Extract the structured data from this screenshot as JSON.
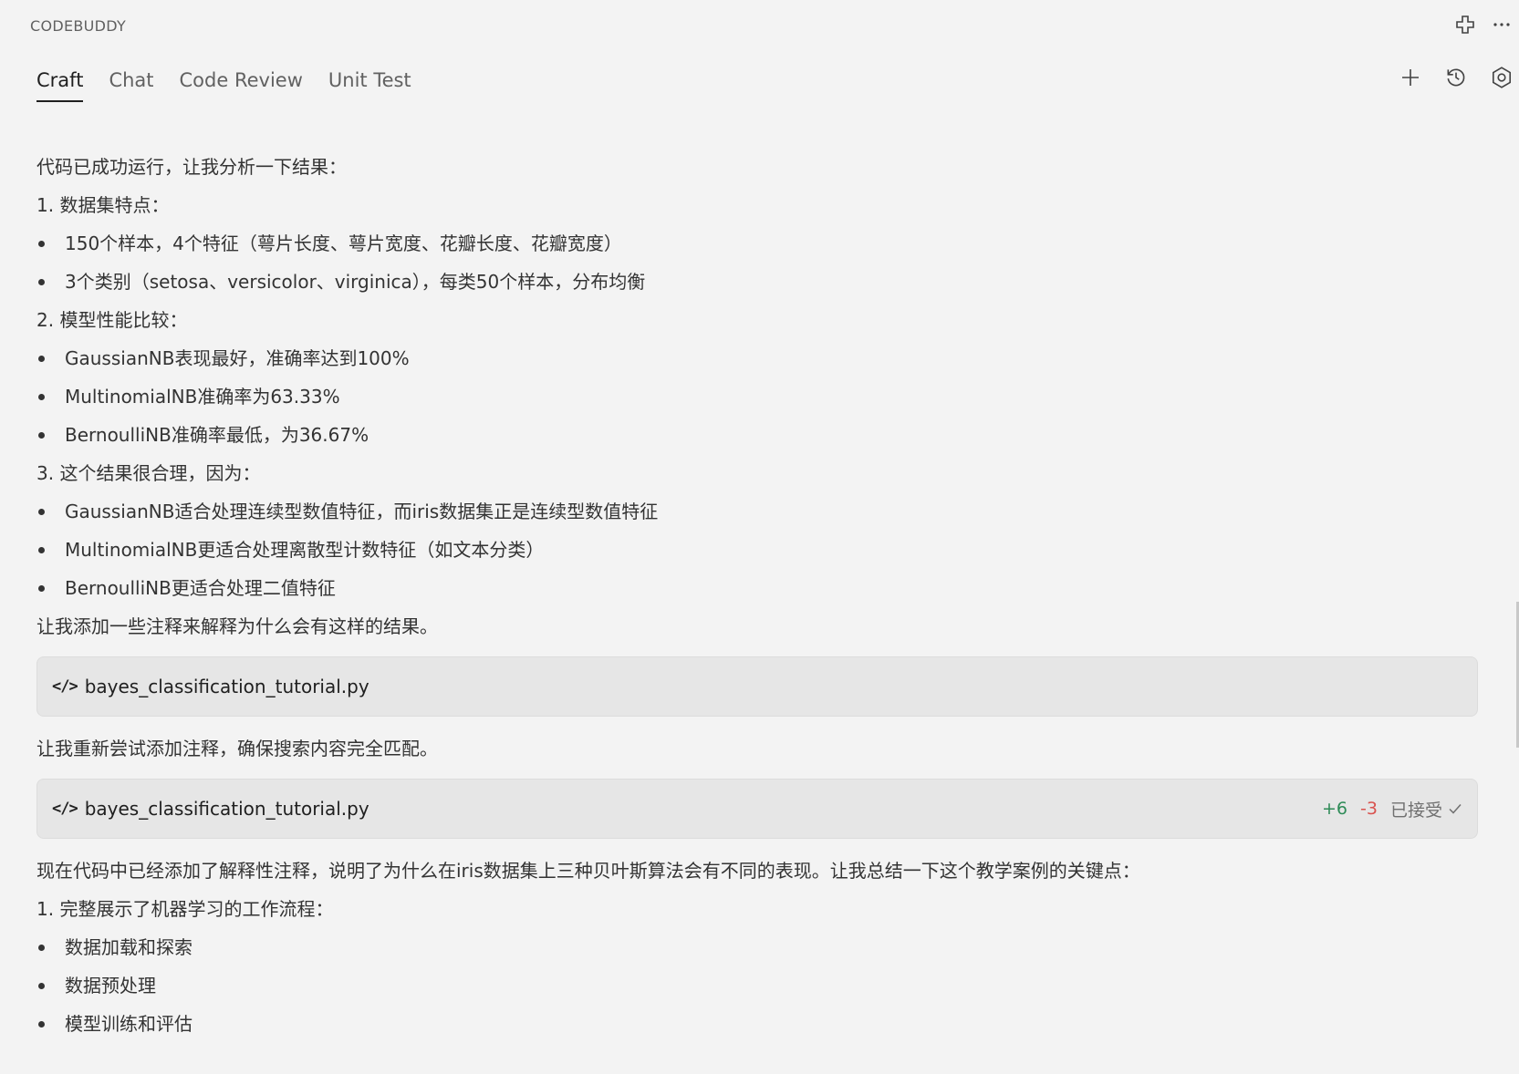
{
  "app": {
    "title": "CODEBUDDY"
  },
  "top_actions": [
    {
      "name": "extensions-icon"
    },
    {
      "name": "more-icon"
    }
  ],
  "tabs": [
    {
      "label": "Craft",
      "active": true
    },
    {
      "label": "Chat",
      "active": false
    },
    {
      "label": "Code Review",
      "active": false
    },
    {
      "label": "Unit Test",
      "active": false
    }
  ],
  "tab_actions": [
    "add-icon",
    "history-icon",
    "settings-icon"
  ],
  "message": {
    "intro": "代码已成功运行，让我分析一下结果：",
    "section1": {
      "heading": "1. 数据集特点：",
      "items": [
        "150个样本，4个特征（萼片长度、萼片宽度、花瓣长度、花瓣宽度）",
        "3个类别（setosa、versicolor、virginica），每类50个样本，分布均衡"
      ]
    },
    "section2": {
      "heading": "2. 模型性能比较：",
      "items": [
        "GaussianNB表现最好，准确率达到100%",
        "MultinomialNB准确率为63.33%",
        "BernoulliNB准确率最低，为36.67%"
      ]
    },
    "section3": {
      "heading": "3. 这个结果很合理，因为：",
      "items": [
        "GaussianNB适合处理连续型数值特征，而iris数据集正是连续型数值特征",
        "MultinomialNB更适合处理离散型计数特征（如文本分类）",
        "BernoulliNB更适合处理二值特征"
      ]
    },
    "line_add_comments": "让我添加一些注释来解释为什么会有这样的结果。",
    "file_card_1": {
      "filename": "bayes_classification_tutorial.py"
    },
    "line_retry": "让我重新尝试添加注释，确保搜索内容完全匹配。",
    "file_card_2": {
      "filename": "bayes_classification_tutorial.py",
      "added": "+6",
      "removed": "-3",
      "status": "已接受"
    },
    "summary": "现在代码中已经添加了解释性注释，说明了为什么在iris数据集上三种贝叶斯算法会有不同的表现。让我总结一下这个教学案例的关键点：",
    "section4": {
      "heading": "1. 完整展示了机器学习的工作流程：",
      "items": [
        "数据加载和探索",
        "数据预处理",
        "模型训练和评估"
      ]
    }
  },
  "colors": {
    "background": "#f3f3f3",
    "card": "#e6e6e6",
    "added": "#2e8b57",
    "removed": "#d9534f"
  }
}
